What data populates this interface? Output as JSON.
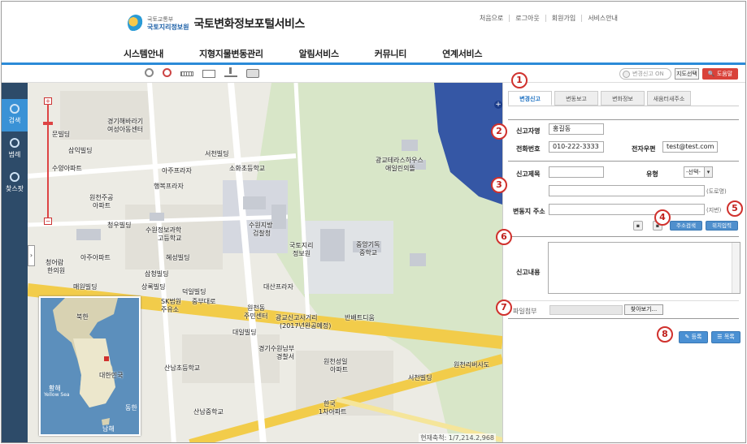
{
  "header": {
    "ministry": "국토교통부",
    "agency": "국토지리정보원",
    "title": "국토변화정보포털서비스",
    "top_links": [
      "처음으로",
      "로그아웃",
      "회원가입",
      "서비스안내"
    ],
    "nav": [
      "시스템안내",
      "지형지물변동관리",
      "알림서비스",
      "커뮤니티",
      "연계서비스"
    ]
  },
  "toolbar": {
    "icons": [
      "zoom-in-icon",
      "zoom-out-icon",
      "ruler-icon",
      "area-icon",
      "download-icon",
      "print-icon"
    ],
    "report_toggle": "변경신고 ON",
    "map_select": "지도선택",
    "help": "도움말"
  },
  "left_rail": [
    {
      "label": "검색",
      "icon": "search-icon",
      "active": true
    },
    {
      "label": "범례",
      "icon": "legend-icon",
      "active": false
    },
    {
      "label": "찾스팟",
      "icon": "spot-icon",
      "active": false
    }
  ],
  "map": {
    "labels": [
      "문빌딩",
      "경기해바라기",
      "여성아동센터",
      "삼익빌딩",
      "수양아파트",
      "아주프라자",
      "서천빌딩",
      "소화초등학교",
      "광교테라스하우스",
      "애일린의뜰",
      "행복프라자",
      "원천주공",
      "아파트",
      "수원정보과학",
      "고등학교",
      "청우빌딩",
      "수원지방",
      "검찰청",
      "국토지리",
      "정보원",
      "중앙기독",
      "중학교",
      "아주아파트",
      "혜성빌딩",
      "삼청빌딩",
      "청어람",
      "한의원",
      "매원빌딩",
      "상록빌딩",
      "덕일빌딩",
      "대산프라자",
      "SK법원",
      "주유소",
      "중부대로",
      "원천동",
      "주민센터",
      "광교신고사거리",
      "반배트디움",
      "(2017년완공예정)",
      "대일빌딩",
      "경기수원남부",
      "경찰서",
      "원천성일",
      "아파트",
      "산남초등학교",
      "서천빌딩",
      "산남중학교",
      "한국",
      "1차아파트",
      "원천리버사도"
    ],
    "overview_labels": [
      "북한",
      "대한민국",
      "황해",
      "Yellow Sea",
      "남해",
      "동한"
    ],
    "scale": "현재축척: 1/7,214.2,968"
  },
  "panel": {
    "tabs": [
      "변경신고",
      "변동보고",
      "변화정보",
      "새움터새주소"
    ],
    "reporter_label": "신고자명",
    "reporter_value": "홍길동",
    "phone_label": "전화번호",
    "phone_value": "010-222-3333",
    "email_label": "전자우편",
    "email_value": "test@test.com",
    "subject_label": "신고제목",
    "type_label": "유형",
    "type_value": "-선택-",
    "address_label": "변동지 주소",
    "road_hint": "(도로명)",
    "lot_hint": "(지번)",
    "address_search": "주소검색",
    "location_input": "위치입력",
    "content_label": "신고내용",
    "file_label": "파일첨부",
    "browse": "찾아보기...",
    "submit": "등록",
    "list": "목록"
  },
  "callouts": [
    "1",
    "2",
    "3",
    "4",
    "5",
    "6",
    "7",
    "8"
  ],
  "colors": {
    "accent": "#2b8bd8",
    "rail": "#2d4b69",
    "help": "#d9423a",
    "callout": "#d0312d",
    "button": "#4a90d3"
  }
}
